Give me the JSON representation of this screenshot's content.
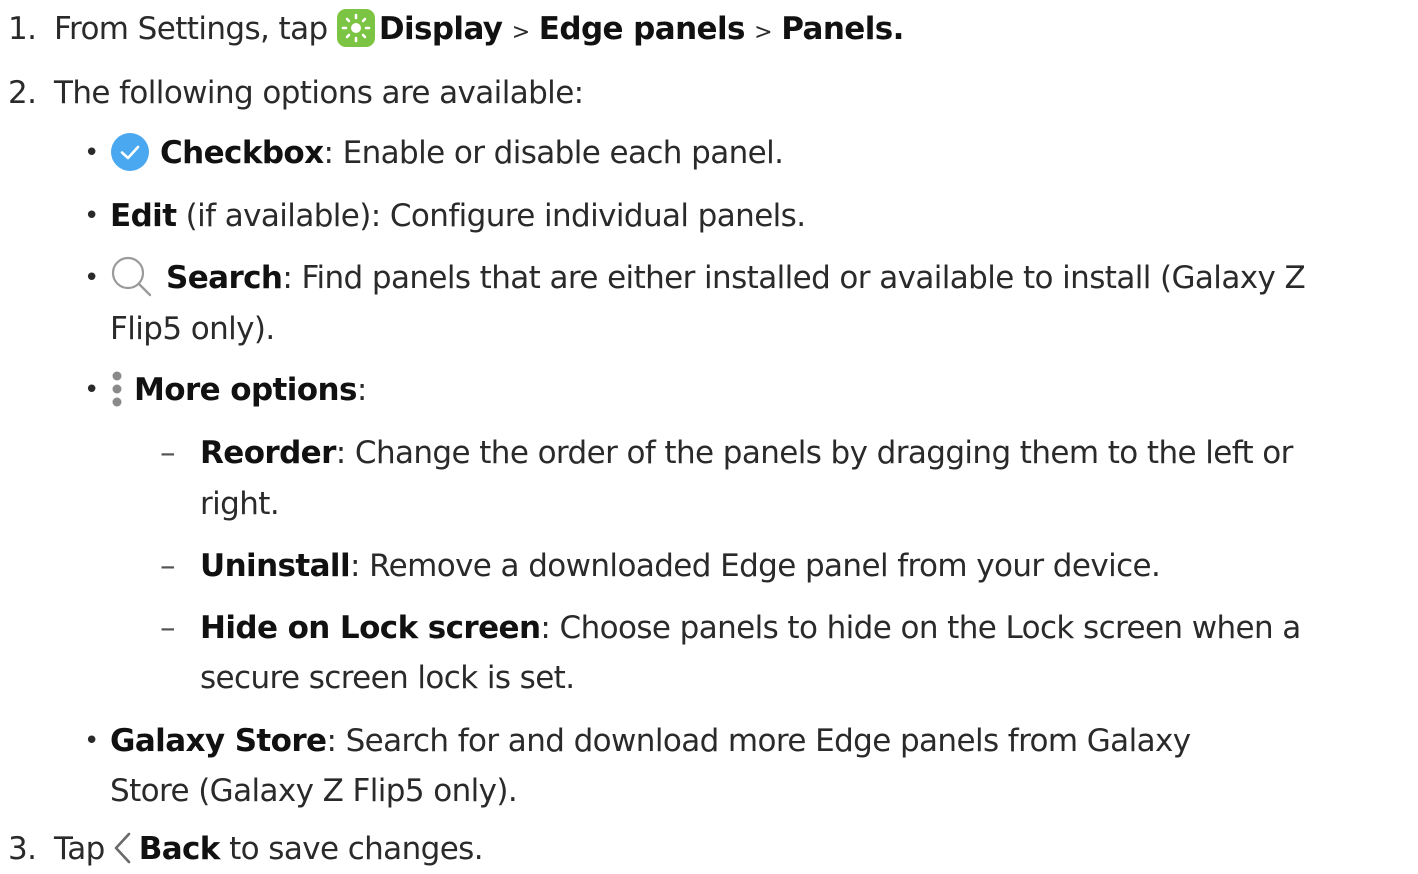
{
  "steps": [
    {
      "number": "1.",
      "parts": {
        "a": "From Settings, tap",
        "b": "Display",
        "c": ">",
        "d": "Edge panels",
        "e": ">",
        "f": "Panels."
      }
    },
    {
      "number": "2.",
      "text": "The following options are available:"
    },
    {
      "number": "3.",
      "parts": {
        "a": "Tap",
        "b": "Back",
        "c": "to save changes."
      }
    }
  ],
  "options": {
    "checkbox": {
      "label": "Checkbox",
      "text": ": Enable or disable each panel."
    },
    "edit": {
      "label": "Edit",
      "text": " (if available): Configure individual panels."
    },
    "search": {
      "label": "Search",
      "line1": ": Find panels that are either installed or available to install (Galaxy Z",
      "line2": "Flip5 only)."
    },
    "more_options": {
      "label": "More options",
      "text": ":"
    },
    "reorder": {
      "label": "Reorder",
      "line1": ": Change the order of the panels by dragging them to the left or",
      "line2": "right."
    },
    "uninstall": {
      "label": "Uninstall",
      "text": ": Remove a downloaded Edge panel from your device."
    },
    "hide_lock": {
      "label": "Hide on Lock screen",
      "line1": ": Choose panels to hide on the Lock screen when a",
      "line2": "secure screen lock is set."
    },
    "galaxy_store": {
      "label": "Galaxy Store",
      "line1": ": Search for and download more Edge panels from Galaxy",
      "line2": "Store (Galaxy Z Flip5 only)."
    }
  },
  "markers": {
    "bullet": "•",
    "dash": "–"
  },
  "icons": {
    "display": "sun-icon",
    "checkbox": "check-circle-icon",
    "search": "search-icon",
    "more": "more-options-icon",
    "back": "back-chevron-icon"
  },
  "colors": {
    "display_icon_bg": "#7cc443",
    "checkbox_icon": "#4aa8f0",
    "text": "#2a2a2a"
  }
}
